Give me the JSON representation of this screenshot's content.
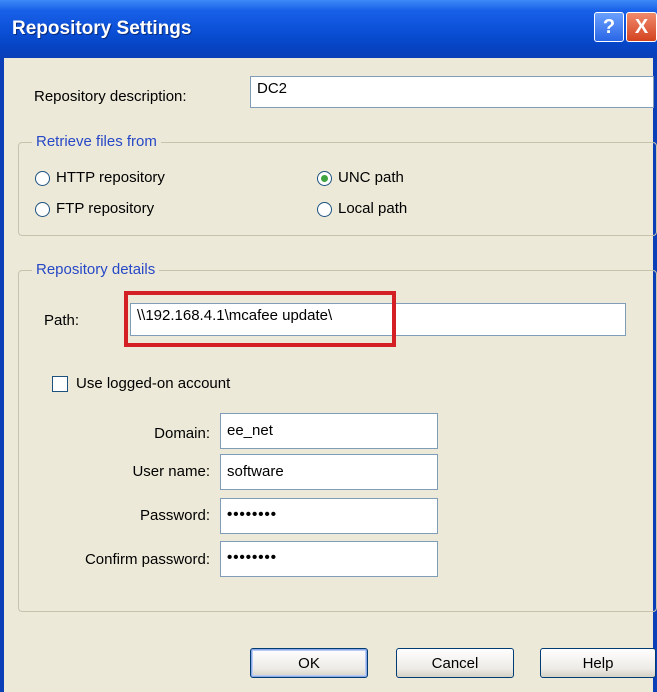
{
  "window": {
    "title": "Repository Settings",
    "help_glyph": "?",
    "close_glyph": "X"
  },
  "description": {
    "label": "Repository description:",
    "value": "DC2"
  },
  "retrieve": {
    "legend": "Retrieve files from",
    "options": [
      {
        "label": "HTTP repository",
        "checked": false
      },
      {
        "label": "FTP repository",
        "checked": false
      },
      {
        "label": "UNC path",
        "checked": true
      },
      {
        "label": "Local path",
        "checked": false
      }
    ]
  },
  "details": {
    "legend": "Repository details",
    "path_label": "Path:",
    "path_value": "\\\\192.168.4.1\\mcafee update\\",
    "use_account_label": "Use logged-on account",
    "use_account_checked": false,
    "domain_label": "Domain:",
    "domain_value": "ee_net",
    "username_label": "User name:",
    "username_value": "software",
    "password_label": "Password:",
    "password_value": "••••••••",
    "confirm_label": "Confirm password:",
    "confirm_value": "••••••••"
  },
  "buttons": {
    "ok": "OK",
    "cancel": "Cancel",
    "help": "Help"
  },
  "colors": {
    "titlebar": "#0a4fd6",
    "legend_text": "#2748c7",
    "highlight": "#d41f25"
  }
}
